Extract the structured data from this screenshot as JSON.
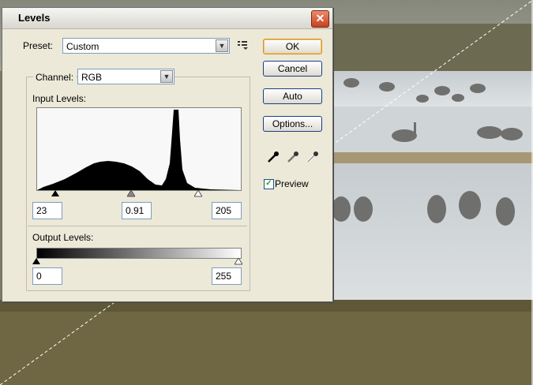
{
  "dialog": {
    "title": "Levels",
    "close_label": "✕",
    "preset_label": "Preset:",
    "preset_value": "Custom",
    "channel_label": "Channel:",
    "channel_value": "RGB",
    "input_levels_label": "Input Levels:",
    "input_black": "23",
    "input_gamma": "0.91",
    "input_white": "205",
    "output_levels_label": "Output Levels:",
    "output_black": "0",
    "output_white": "255",
    "buttons": {
      "ok": "OK",
      "cancel": "Cancel",
      "auto": "Auto",
      "options": "Options..."
    },
    "preview_label": "Preview",
    "preview_checked": true
  },
  "colors": {
    "dialog_bg": "#ece9d8",
    "close_red": "#c8401e",
    "ok_border": "#d4932b"
  },
  "icons": [
    "close-icon",
    "dropdown-arrow-icon",
    "preset-menu-icon",
    "black-eyedropper-icon",
    "gray-eyedropper-icon",
    "white-eyedropper-icon",
    "checkmark-icon",
    "black-point-slider-icon",
    "gamma-slider-icon",
    "white-point-slider-icon"
  ]
}
